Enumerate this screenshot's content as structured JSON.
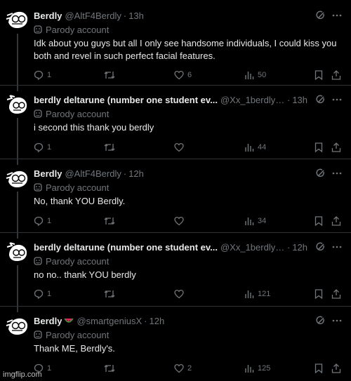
{
  "tweets": [
    {
      "name": "Berdly",
      "handle": "@AltF4Berdly",
      "time": "13h",
      "emoji": "",
      "label": "Parody account",
      "text": "Idk about you guys but all I only see handsome individuals, I could kiss you both and revel in such perfect facial features.",
      "replies": "1",
      "reposts": "",
      "likes": "6",
      "views": "50"
    },
    {
      "name": "berdly deltarune (number one student ev...",
      "handle": "@Xx_1berdly1_...",
      "time": "13h",
      "emoji": "",
      "label": "Parody account",
      "text": "i second this thank you berdly",
      "replies": "1",
      "reposts": "",
      "likes": "",
      "views": "44"
    },
    {
      "name": "Berdly",
      "handle": "@AltF4Berdly",
      "time": "12h",
      "emoji": "",
      "label": "Parody account",
      "text": "No, thank YOU Berdly.",
      "replies": "1",
      "reposts": "",
      "likes": "",
      "views": "34"
    },
    {
      "name": "berdly deltarune (number one student ev...",
      "handle": "@Xx_1berdly1_...",
      "time": "12h",
      "emoji": "",
      "label": "Parody account",
      "text": "no no.. thank YOU berdly",
      "replies": "1",
      "reposts": "",
      "likes": "",
      "views": "121"
    },
    {
      "name": "Berdly",
      "handle": "@smartgeniusX",
      "time": "12h",
      "emoji": "watermelon-emoji",
      "label": "Parody account",
      "text": "Thank ME, Berdly's.",
      "replies": "1",
      "reposts": "",
      "likes": "2",
      "views": "125"
    }
  ],
  "watermark": "imgflip.com",
  "colors": {
    "background": "#000000",
    "text": "#e7e9ea",
    "muted": "#71767b",
    "divider": "#2f3336"
  },
  "icons": [
    "reply-icon",
    "repost-icon",
    "like-icon",
    "views-icon",
    "bookmark-icon",
    "share-icon",
    "grok-icon",
    "more-icon",
    "parody-mask-icon"
  ]
}
